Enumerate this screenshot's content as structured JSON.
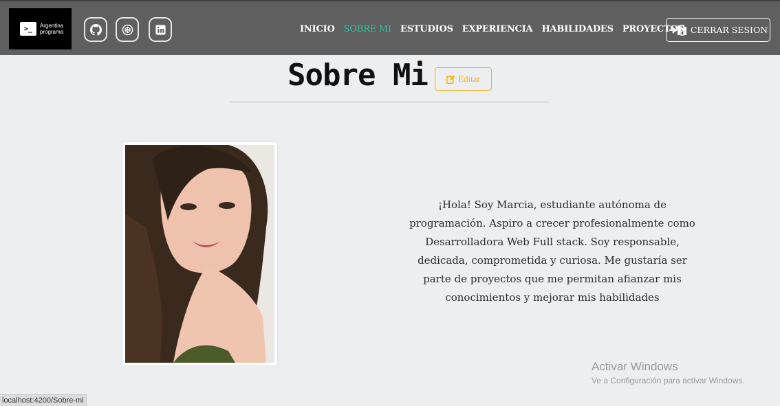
{
  "brand": {
    "mark": ">_",
    "line1": "Argentina",
    "line2": "programa"
  },
  "social": [
    {
      "name": "github-icon"
    },
    {
      "name": "codepen-icon"
    },
    {
      "name": "linkedin-icon"
    }
  ],
  "nav": {
    "items": [
      {
        "label": "INICIO",
        "active": false
      },
      {
        "label": "SOBRE MI",
        "active": true
      },
      {
        "label": "ESTUDIOS",
        "active": false
      },
      {
        "label": "EXPERIENCIA",
        "active": false
      },
      {
        "label": "HABILIDADES",
        "active": false
      },
      {
        "label": "PROYECTOS",
        "active": false
      }
    ],
    "logout_label": "CERRAR SESION"
  },
  "section": {
    "title": "Sobre Mi",
    "edit_label": "Editar",
    "about_lines": [
      "¡Hola! Soy Marcia, estudiante autónoma de",
      "programación. Aspiro a crecer profesionalmente como",
      "Desarrolladora Web Full stack. Soy responsable,",
      "dedicada, comprometida y curiosa. Me gustaría ser",
      "parte de proyectos que me permitan afianzar mis",
      "conocimientos y mejorar mis habilidades"
    ]
  },
  "watermark": {
    "title": "Activar Windows",
    "subtitle": "Ve a Configuración para activar Windows."
  },
  "statusbar": {
    "url": "localhost:4200/Sobre-mi"
  },
  "colors": {
    "navbar": "#5f5f5f",
    "active_link": "#2ec4a6",
    "edit_accent": "#f0b414",
    "background": "#eceef0"
  }
}
